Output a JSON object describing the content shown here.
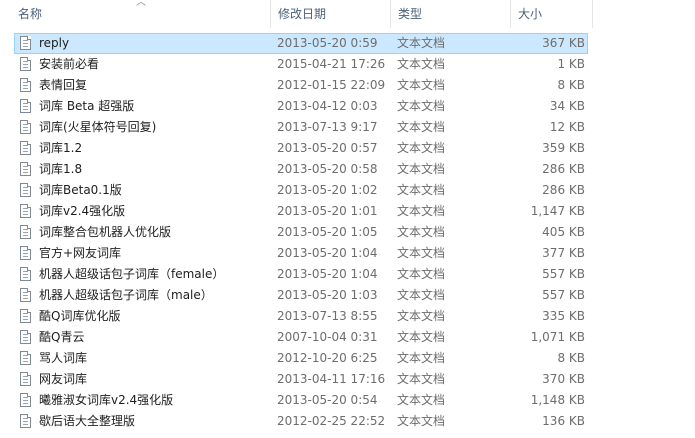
{
  "columns": {
    "name": "名称",
    "date": "修改日期",
    "type": "类型",
    "size": "大小",
    "sort_indicator": "chevron-up-icon"
  },
  "colors": {
    "selection_bg": "#cce8ff",
    "selection_border": "#99d1ff",
    "header_text": "#4c607a",
    "detail_text": "#6d6d6d"
  },
  "selected_index": 0,
  "files": [
    {
      "name": "reply",
      "date": "2013-05-20 0:59",
      "type": "文本文档",
      "size": "367 KB"
    },
    {
      "name": "安装前必看",
      "date": "2015-04-21 17:26",
      "type": "文本文档",
      "size": "1 KB"
    },
    {
      "name": "表情回复",
      "date": "2012-01-15 22:09",
      "type": "文本文档",
      "size": "8 KB"
    },
    {
      "name": "词库 Beta 超强版",
      "date": "2013-04-12 0:03",
      "type": "文本文档",
      "size": "34 KB"
    },
    {
      "name": "词库(火星体符号回复)",
      "date": "2013-07-13 9:17",
      "type": "文本文档",
      "size": "12 KB"
    },
    {
      "name": "词库1.2",
      "date": "2013-05-20 0:57",
      "type": "文本文档",
      "size": "359 KB"
    },
    {
      "name": "词库1.8",
      "date": "2013-05-20 0:58",
      "type": "文本文档",
      "size": "286 KB"
    },
    {
      "name": "词库Beta0.1版",
      "date": "2013-05-20 1:02",
      "type": "文本文档",
      "size": "286 KB"
    },
    {
      "name": "词库v2.4强化版",
      "date": "2013-05-20 1:01",
      "type": "文本文档",
      "size": "1,147 KB"
    },
    {
      "name": "词库整合包机器人优化版",
      "date": "2013-05-20 1:05",
      "type": "文本文档",
      "size": "405 KB"
    },
    {
      "name": "官方+网友词库",
      "date": "2013-05-20 1:04",
      "type": "文本文档",
      "size": "377 KB"
    },
    {
      "name": "机器人超级话包子词库（female）",
      "date": "2013-05-20 1:04",
      "type": "文本文档",
      "size": "557 KB"
    },
    {
      "name": "机器人超级话包子词库（male）",
      "date": "2013-05-20 1:03",
      "type": "文本文档",
      "size": "557 KB"
    },
    {
      "name": "酷Q词库优化版",
      "date": "2013-07-13 8:55",
      "type": "文本文档",
      "size": "335 KB"
    },
    {
      "name": "酷Q青云",
      "date": "2007-10-04 0:31",
      "type": "文本文档",
      "size": "1,071 KB"
    },
    {
      "name": "骂人词库",
      "date": "2012-10-20 6:25",
      "type": "文本文档",
      "size": "8 KB"
    },
    {
      "name": "网友词库",
      "date": "2013-04-11 17:16",
      "type": "文本文档",
      "size": "370 KB"
    },
    {
      "name": "曦雅淑女词库v2.4强化版",
      "date": "2013-05-20 0:54",
      "type": "文本文档",
      "size": "1,148 KB"
    },
    {
      "name": "歇后语大全整理版",
      "date": "2012-02-25 22:52",
      "type": "文本文档",
      "size": "136 KB"
    }
  ]
}
